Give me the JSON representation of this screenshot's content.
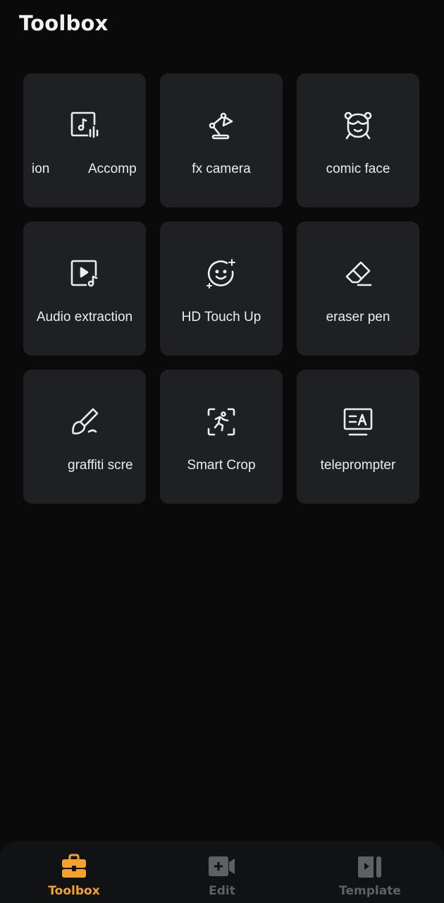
{
  "header": {
    "title": "Toolbox"
  },
  "tools": [
    {
      "icon": "music-video-icon",
      "label_parts": [
        "ion",
        "Accomp"
      ]
    },
    {
      "icon": "desk-lamp-icon",
      "label": "fx camera"
    },
    {
      "icon": "comic-face-icon",
      "label": "comic face"
    },
    {
      "icon": "video-music-icon",
      "label": "Audio extraction"
    },
    {
      "icon": "face-sparkle-icon",
      "label": "HD Touch Up"
    },
    {
      "icon": "eraser-icon",
      "label": "eraser pen"
    },
    {
      "icon": "brush-icon",
      "label": "graffiti scre"
    },
    {
      "icon": "person-crop-icon",
      "label": "Smart Crop"
    },
    {
      "icon": "teleprompter-icon",
      "label": "teleprompter"
    }
  ],
  "nav": {
    "items": [
      {
        "label": "Toolbox",
        "icon": "toolbox-icon",
        "active": true
      },
      {
        "label": "Edit",
        "icon": "video-add-icon",
        "active": false
      },
      {
        "label": "Template",
        "icon": "template-icon",
        "active": false
      }
    ]
  },
  "colors": {
    "accent": "#f3a32b",
    "inactive": "#5f6064",
    "card": "#1f2024",
    "background": "#0a0a0a"
  }
}
